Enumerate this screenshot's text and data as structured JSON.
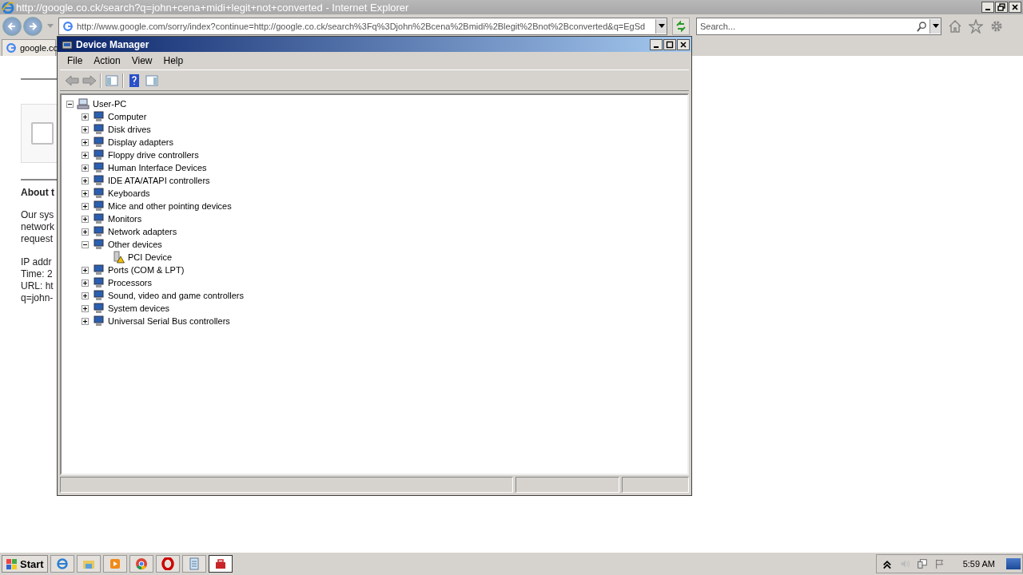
{
  "browser": {
    "title": "http://google.co.ck/search?q=john+cena+midi+legit+not+converted - Internet Explorer",
    "address": "http://www.google.com/sorry/index?continue=http://google.co.ck/search%3Fq%3Djohn%2Bcena%2Bmidi%2Blegit%2Bnot%2Bconverted&q=EgSd",
    "search": {
      "placeholder": "Search..."
    },
    "tab": {
      "label": "google.co",
      "selected": true
    },
    "page": {
      "captcha": {
        "checked": false
      },
      "heading": "About t",
      "paragraph": [
        "Our sys",
        "network",
        "request"
      ],
      "details": [
        "IP addr",
        "Time: 2",
        "URL: ht",
        "q=john-"
      ]
    }
  },
  "window": {
    "title": "Device Manager",
    "menu": [
      "File",
      "Action",
      "View",
      "Help"
    ],
    "tree": {
      "label": "User-PC",
      "expanded": true,
      "children": [
        {
          "label": "Computer",
          "expanded": false
        },
        {
          "label": "Disk drives",
          "expanded": false
        },
        {
          "label": "Display adapters",
          "expanded": false
        },
        {
          "label": "Floppy drive controllers",
          "expanded": false
        },
        {
          "label": "Human Interface Devices",
          "expanded": false
        },
        {
          "label": "IDE ATA/ATAPI controllers",
          "expanded": false
        },
        {
          "label": "Keyboards",
          "expanded": false
        },
        {
          "label": "Mice and other pointing devices",
          "expanded": false
        },
        {
          "label": "Monitors",
          "expanded": false
        },
        {
          "label": "Network adapters",
          "expanded": false
        },
        {
          "label": "Other devices",
          "expanded": true,
          "children": [
            {
              "label": "PCI Device",
              "kind": "warning"
            }
          ]
        },
        {
          "label": "Ports (COM & LPT)",
          "expanded": false
        },
        {
          "label": "Processors",
          "expanded": false
        },
        {
          "label": "Sound, video and game controllers",
          "expanded": false
        },
        {
          "label": "System devices",
          "expanded": false
        },
        {
          "label": "Universal Serial Bus controllers",
          "expanded": false
        }
      ]
    }
  },
  "taskbar": {
    "start": "Start",
    "clock": "5:59 AM"
  }
}
